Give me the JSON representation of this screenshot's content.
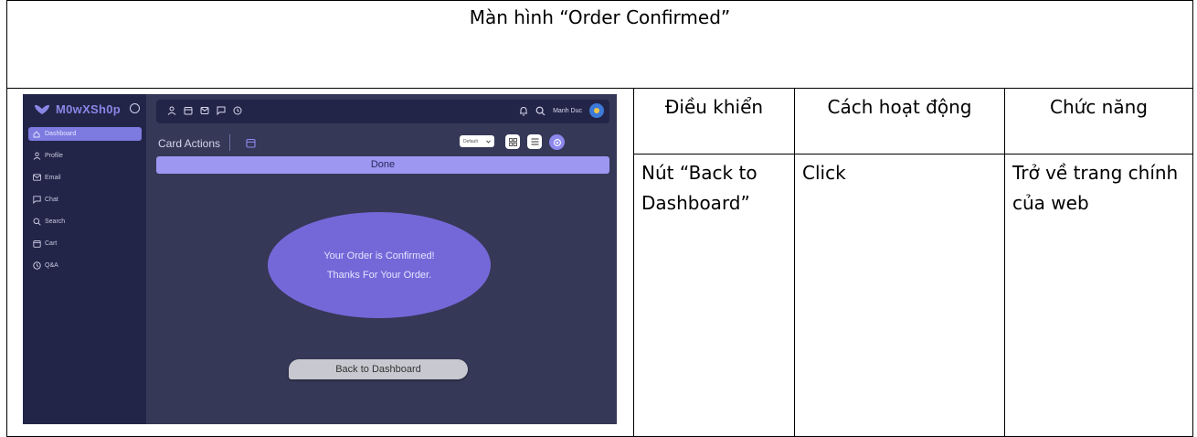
{
  "document": {
    "title": "Màn hình “Order Confirmed”",
    "columns": [
      "Điều khiển",
      "Cách hoạt động",
      "Chức năng"
    ],
    "rows": [
      {
        "control": "Nút “Back to Dashboard”",
        "action": "Click",
        "function": "Trở về trang chính của web"
      }
    ]
  },
  "app": {
    "brand": "M0wXSh0p",
    "nav": [
      {
        "label": "Dashboard",
        "icon": "home-icon",
        "active": true
      },
      {
        "label": "Profile",
        "icon": "user-icon",
        "active": false
      },
      {
        "label": "Email",
        "icon": "mail-icon",
        "active": false
      },
      {
        "label": "Chat",
        "icon": "chat-icon",
        "active": false
      },
      {
        "label": "Search",
        "icon": "search-icon",
        "active": false
      },
      {
        "label": "Cart",
        "icon": "cart-icon",
        "active": false
      },
      {
        "label": "Q&A",
        "icon": "help-icon",
        "active": false
      }
    ],
    "user_name": "Manh Duc",
    "card_actions_label": "Card Actions",
    "select_value": "Default",
    "done_label": "Done",
    "confirm_line1": "Your Order is Confirmed!",
    "confirm_line2": "Thanks For Your Order.",
    "back_button_label": "Back to Dashboard",
    "colors": {
      "sidebar": "#222548",
      "main": "#353856",
      "accent": "#8d88ee",
      "ellipse": "#7468d9"
    }
  }
}
